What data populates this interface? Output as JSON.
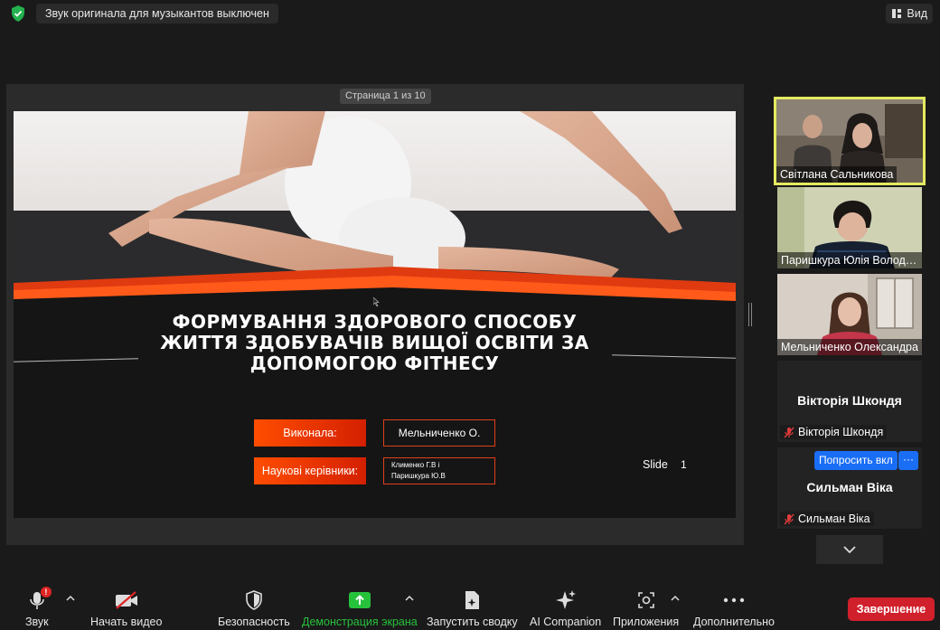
{
  "top_bar": {
    "notice": "Звук оригинала для музыкантов выключен",
    "view_label": "Вид"
  },
  "share": {
    "page_indicator": "Страница 1 из 10",
    "slide": {
      "title": "ФОРМУВАННЯ ЗДОРОВОГО СПОСОБУ ЖИТТЯ ЗДОБУВАЧІВ ВИЩОЇ ОСВІТИ ЗА ДОПОМОГОЮ ФІТНЕСУ",
      "author_label": "Виконала:",
      "author_value": "Мельниченко О.",
      "supervisors_label": "Наукові керівники:",
      "supervisor_1": "Клименко Г.В і",
      "supervisor_2": "Паришкура Ю.В",
      "slide_label": "Slide",
      "slide_number": "1",
      "accent_color": "#ff4d00"
    }
  },
  "participants": [
    {
      "name": "Світлана Сальникова",
      "active": true,
      "video": true
    },
    {
      "name": "Паришкура Юлія Володимирівна",
      "video": true
    },
    {
      "name": "Мельниченко Олександра",
      "video": true
    },
    {
      "name": "Вікторія Шкондя",
      "display_name": "Вікторія Шкондя",
      "muted": true,
      "video": false
    },
    {
      "name": "Сильман Віка",
      "display_name": "Сильман Віка",
      "muted": true,
      "video": false,
      "ask_label": "Попросить вкл",
      "more_label": "···"
    }
  ],
  "toolbar": {
    "audio": "Звук",
    "video": "Начать видео",
    "security": "Безопасность",
    "share": "Демонстрация экрана",
    "summary": "Запустить сводку",
    "ai": "AI Companion",
    "apps": "Приложения",
    "more": "Дополнительно",
    "end": "Завершение",
    "audio_badge": "!"
  },
  "colors": {
    "active_speaker_border": "#e5ea60",
    "end_button": "#d0202c",
    "share_green": "#27c23c",
    "ask_button": "#1a6ef5"
  }
}
